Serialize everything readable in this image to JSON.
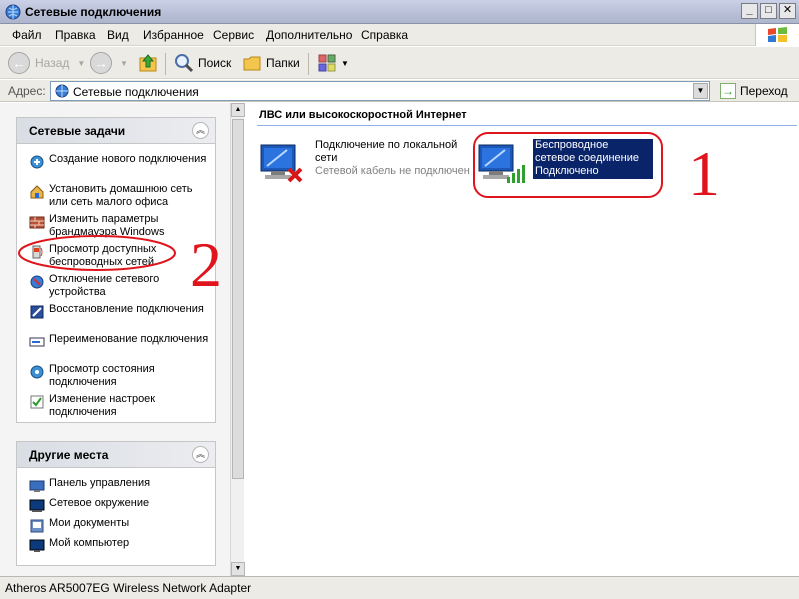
{
  "window": {
    "title": "Сетевые подключения"
  },
  "menu": [
    "Файл",
    "Правка",
    "Вид",
    "Избранное",
    "Сервис",
    "Дополнительно",
    "Справка"
  ],
  "toolbar": {
    "back_label": "Назад",
    "search_label": "Поиск",
    "folders_label": "Папки"
  },
  "address": {
    "label": "Адрес:",
    "value": "Сетевые подключения",
    "go_label": "Переход"
  },
  "tasks_panel": {
    "title": "Сетевые задачи",
    "items": [
      "Создание нового подключения",
      "Установить домашнюю сеть или сеть малого офиса",
      "Изменить параметры брандмауэра Windows",
      "Просмотр доступных беспроводных сетей",
      "Отключение сетевого устройства",
      "Восстановление подключения",
      "Переименование подключения",
      "Просмотр состояния подключения",
      "Изменение настроек подключения"
    ]
  },
  "places_panel": {
    "title": "Другие места",
    "items": [
      "Панель управления",
      "Сетевое окружение",
      "Мои документы",
      "Мой компьютер"
    ]
  },
  "content": {
    "group_title": "ЛВС или высокоскоростной Интернет",
    "connections": [
      {
        "name": "Подключение по локальной сети",
        "status": "Сетевой кабель не подключен"
      },
      {
        "name": "Беспроводное сетевое соединение",
        "status": "Подключено"
      }
    ]
  },
  "annotations": {
    "mark1": "1",
    "mark2": "2",
    "color": "#e0141c"
  },
  "statusbar": {
    "text": "Atheros AR5007EG Wireless Network Adapter"
  }
}
